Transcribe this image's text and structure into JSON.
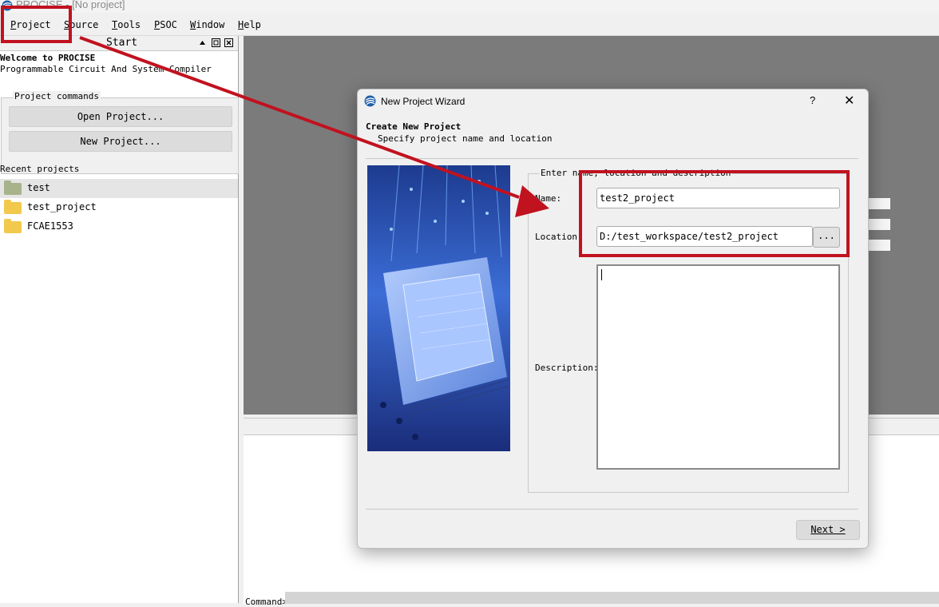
{
  "window": {
    "title": "PROCISE - [No project]"
  },
  "menubar": {
    "items": [
      {
        "first": "P",
        "rest": "roject"
      },
      {
        "first": "S",
        "rest": "ource"
      },
      {
        "first": "T",
        "rest": "ools"
      },
      {
        "first": "P",
        "rest": "SOC"
      },
      {
        "first": "W",
        "rest": "indow"
      },
      {
        "first": "H",
        "rest": "elp"
      }
    ]
  },
  "start_panel": {
    "title": "Start",
    "welcome_title": "Welcome to PROCISE",
    "welcome_subtitle": "Programmable Circuit And System Compiler",
    "project_commands_label": "Project commands",
    "open_project_label": "Open Project...",
    "new_project_label": "New Project...",
    "recent_projects_label": "Recent projects",
    "recent_projects": [
      "test",
      "test_project",
      "FCAE1553"
    ]
  },
  "console": {
    "command_label": "Command>"
  },
  "dialog": {
    "title": "New Project Wizard",
    "help_label": "?",
    "close_label": "✕",
    "heading": "Create New Project",
    "subheading": "Specify project name and location",
    "group_label": "Enter name, location and description",
    "name_label": "Name:",
    "name_value": "test2_project",
    "location_label": "Location:",
    "location_value": "D:/test_workspace/test2_project",
    "browse_label": "...",
    "description_label": "Description:",
    "description_value": "",
    "next_label": "Next >"
  },
  "colors": {
    "annotation_red": "#c1121f",
    "workspace_gray": "#7b7b7b",
    "folder_yellow": "#f2c94c",
    "folder_selected": "#a7b38a"
  },
  "icons": [
    "procise-logo-icon",
    "folder-icon",
    "restore-icon",
    "close-icon",
    "triangle-up-icon"
  ]
}
